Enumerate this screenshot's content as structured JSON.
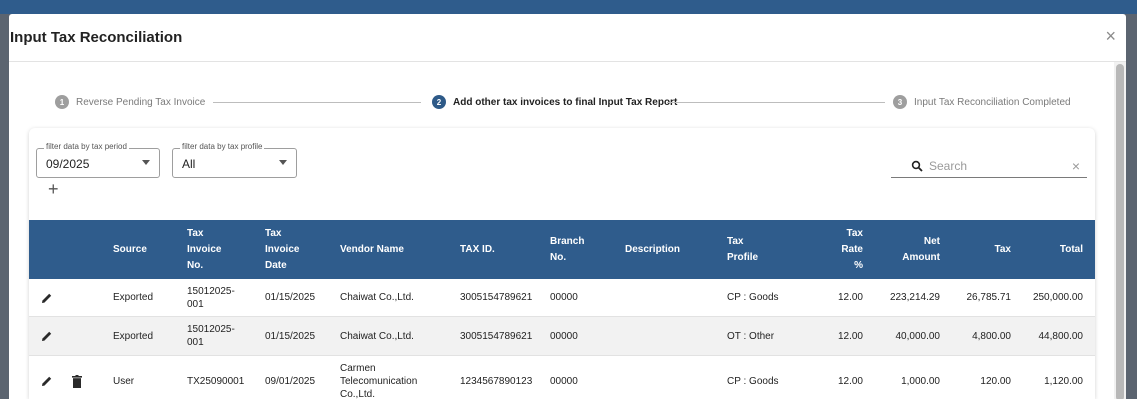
{
  "dialog": {
    "title": "Input Tax Reconciliation",
    "close_icon": "×"
  },
  "stepper": {
    "steps": [
      {
        "number": "1",
        "label": "Reverse Pending Tax Invoice"
      },
      {
        "number": "2",
        "label": "Add other tax invoices to final Input Tax Report"
      },
      {
        "number": "3",
        "label": "Input Tax Reconciliation Completed"
      }
    ],
    "active_step": 2
  },
  "filters": {
    "tax_period": {
      "label": "filter data by tax period",
      "value": "09/2025"
    },
    "tax_profile": {
      "label": "filter data by tax profile",
      "value": "All"
    },
    "add_icon": "+"
  },
  "search": {
    "placeholder": "Search",
    "clear_icon": "×"
  },
  "table": {
    "columns": {
      "source": "Source",
      "tax_invoice_no": [
        "Tax",
        "Invoice",
        "No."
      ],
      "tax_invoice_date": [
        "Tax",
        "Invoice",
        "Date"
      ],
      "vendor_name": "Vendor Name",
      "tax_id": "TAX ID.",
      "branch_no": [
        "Branch",
        "No."
      ],
      "description": "Description",
      "tax_profile": [
        "Tax",
        "Profile"
      ],
      "tax_rate": [
        "Tax",
        "Rate",
        "%"
      ],
      "net_amount": [
        "Net",
        "Amount"
      ],
      "tax": "Tax",
      "total": "Total"
    },
    "rows": [
      {
        "source": "Exported",
        "invoice_no": [
          "15012025-",
          "001"
        ],
        "date": "01/15/2025",
        "vendor": [
          "Chaiwat Co.,Ltd."
        ],
        "tax_id": "3005154789621",
        "branch": "00000",
        "description": "",
        "profile": "CP : Goods",
        "rate": "12.00",
        "net": "223,214.29",
        "tax": "26,785.71",
        "total": "250,000.00"
      },
      {
        "source": "Exported",
        "invoice_no": [
          "15012025-",
          "001"
        ],
        "date": "01/15/2025",
        "vendor": [
          "Chaiwat Co.,Ltd."
        ],
        "tax_id": "3005154789621",
        "branch": "00000",
        "description": "",
        "profile": "OT : Other",
        "rate": "12.00",
        "net": "40,000.00",
        "tax": "4,800.00",
        "total": "44,800.00"
      },
      {
        "source": "User",
        "invoice_no": [
          "TX25090001"
        ],
        "date": "09/01/2025",
        "vendor": [
          "Carmen",
          "Telecomunication",
          "Co.,Ltd."
        ],
        "tax_id": "1234567890123",
        "branch": "00000",
        "description": "",
        "profile": "CP : Goods",
        "rate": "12.00",
        "net": "1,000.00",
        "tax": "120.00",
        "total": "1,120.00"
      }
    ]
  },
  "colors": {
    "header_bg": "#2f5c8c",
    "active_step": "#2e5a88",
    "row_shaded": "#f2f2f2"
  }
}
